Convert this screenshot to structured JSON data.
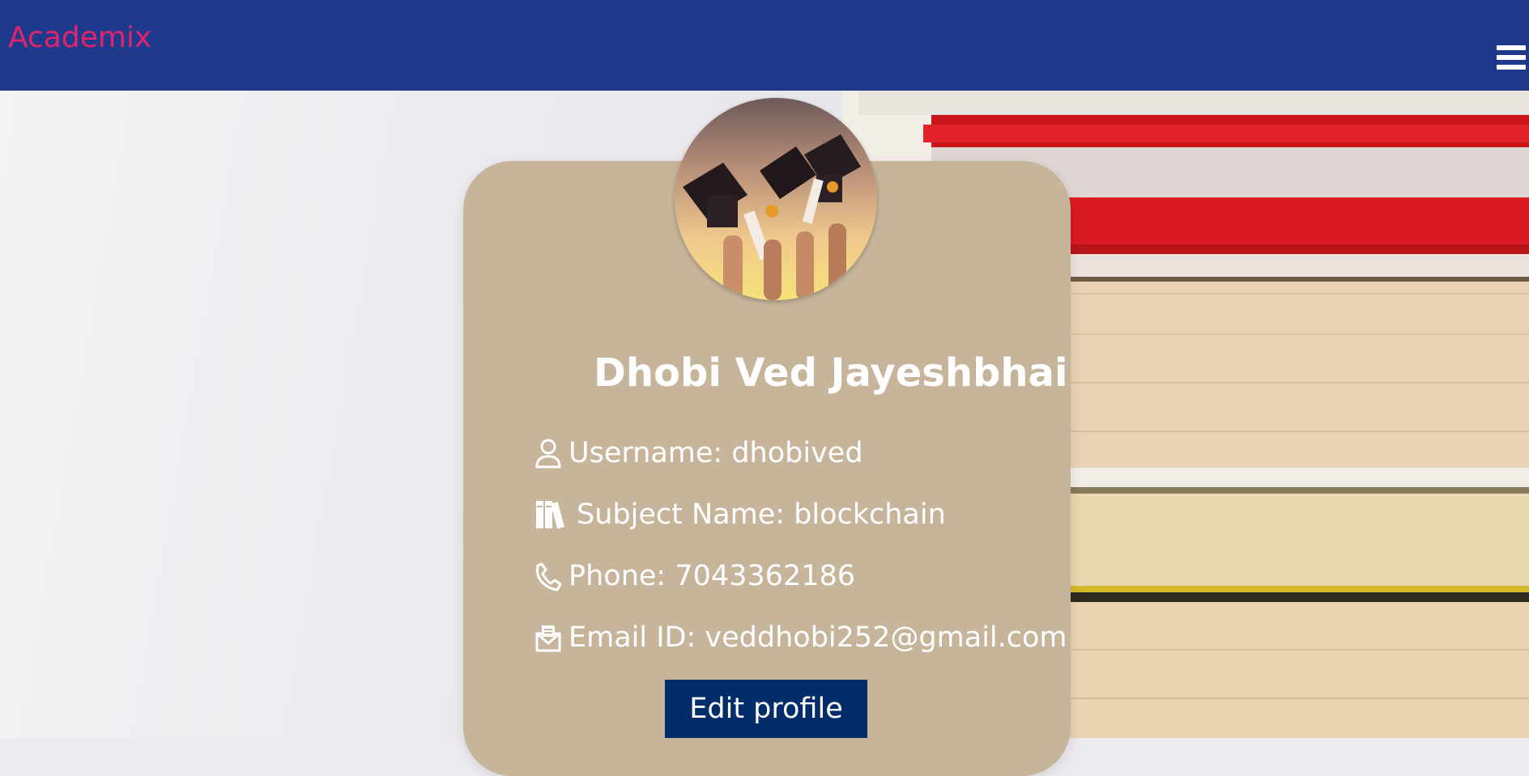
{
  "navbar": {
    "brand": "Academix",
    "menu_icon": "hamburger-menu-icon",
    "background": "#1f3a8c",
    "brand_color": "#e0246a"
  },
  "profile": {
    "name": "Dhobi Ved Jayeshbhai",
    "avatar_description_icon": "graduation-caps-photo",
    "fields": {
      "username": {
        "icon": "user-icon",
        "text": "Username: dhobived"
      },
      "subject": {
        "icon": "books-icon",
        "text": "Subject Name: blockchain"
      },
      "phone": {
        "icon": "phone-icon",
        "text": "Phone: 7043362186"
      },
      "email": {
        "icon": "email-icon",
        "text": "Email ID: veddhobi252@gmail.com"
      }
    },
    "edit_button": "Edit profile",
    "card_color": "#c6b49b",
    "button_color": "#032c6b"
  }
}
